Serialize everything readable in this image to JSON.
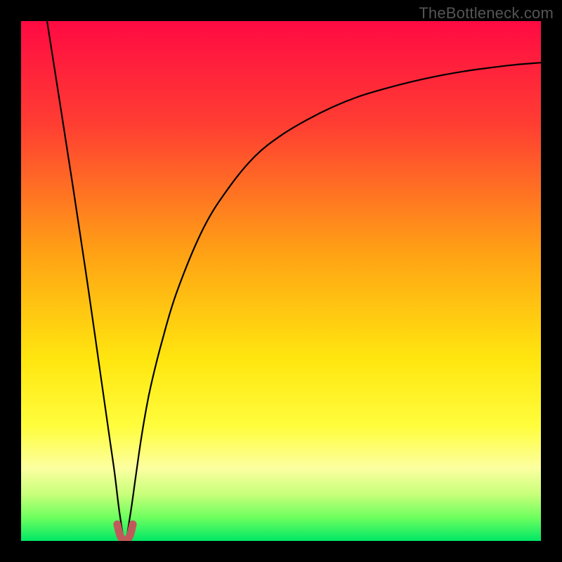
{
  "watermark": "TheBottleneck.com",
  "chart_data": {
    "type": "line",
    "title": "",
    "xlabel": "",
    "ylabel": "",
    "xlim": [
      0,
      100
    ],
    "ylim": [
      0,
      100
    ],
    "grid": false,
    "legend": false,
    "series": [
      {
        "name": "bottleneck-curve",
        "color": "#000000",
        "x": [
          5,
          10,
          13,
          15,
          17,
          18,
          19,
          20,
          21,
          22,
          23,
          24,
          25,
          27,
          30,
          35,
          40,
          45,
          50,
          55,
          60,
          65,
          70,
          75,
          80,
          85,
          90,
          95,
          100
        ],
        "values": [
          100,
          68,
          48,
          34,
          20,
          13,
          5,
          0,
          5,
          12,
          19,
          25,
          30,
          38,
          48,
          60,
          68,
          74,
          78,
          81,
          83.5,
          85.5,
          87,
          88.3,
          89.4,
          90.3,
          91,
          91.6,
          92
        ]
      },
      {
        "name": "minimum-highlight",
        "color": "#c05a5a",
        "x": [
          18.5,
          19,
          19.5,
          20,
          20.5,
          21,
          21.5
        ],
        "values": [
          3.2,
          1.2,
          0.3,
          0,
          0.3,
          1.2,
          3.2
        ]
      }
    ],
    "background": {
      "type": "vertical-gradient",
      "stops": [
        {
          "offset": 0.0,
          "color": "#ff0a43"
        },
        {
          "offset": 0.2,
          "color": "#ff3e32"
        },
        {
          "offset": 0.45,
          "color": "#ffa314"
        },
        {
          "offset": 0.65,
          "color": "#ffe60f"
        },
        {
          "offset": 0.78,
          "color": "#fffd3d"
        },
        {
          "offset": 0.86,
          "color": "#fcffa0"
        },
        {
          "offset": 0.91,
          "color": "#c8ff7a"
        },
        {
          "offset": 0.955,
          "color": "#6dff5e"
        },
        {
          "offset": 1.0,
          "color": "#00e765"
        }
      ]
    }
  }
}
